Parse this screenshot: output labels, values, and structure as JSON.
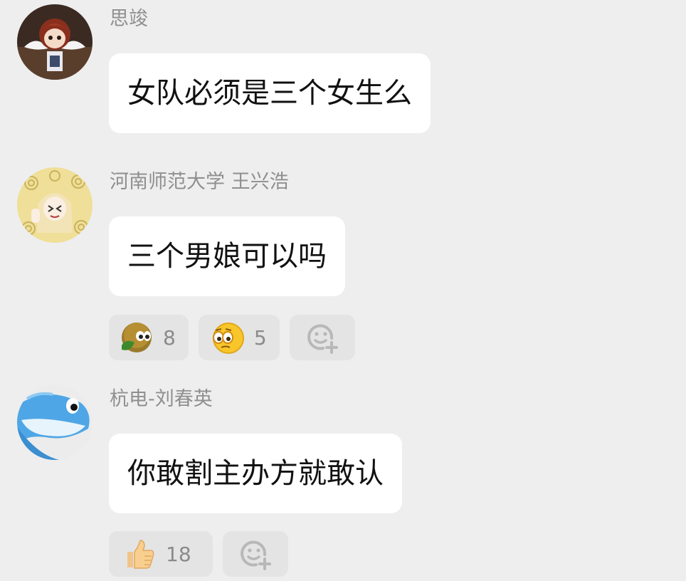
{
  "messages": [
    {
      "sender": "思竣",
      "text": "女队必须是三个女生么",
      "avatar": "anime-girl-winged-avatar",
      "reactions": []
    },
    {
      "sender": "河南师范大学 王兴浩",
      "text": "三个男娘可以吗",
      "avatar": "anime-girl-swirl-avatar",
      "reactions": [
        {
          "icon": "smirk-face-icon",
          "count": "8"
        },
        {
          "icon": "peeking-face-icon",
          "count": "5"
        }
      ]
    },
    {
      "sender": "杭电-刘春英",
      "text": "你敢割主办方就敢认",
      "avatar": "blue-dolphin-avatar",
      "reactions": [
        {
          "icon": "thumbs-up-icon",
          "count": "18"
        }
      ]
    }
  ],
  "add_reaction_icon": "add-reaction-icon",
  "colors": {
    "background": "#eeeeee",
    "bubble": "#ffffff",
    "sender_text": "#8f8f8f",
    "chip": "#e4e4e4"
  }
}
